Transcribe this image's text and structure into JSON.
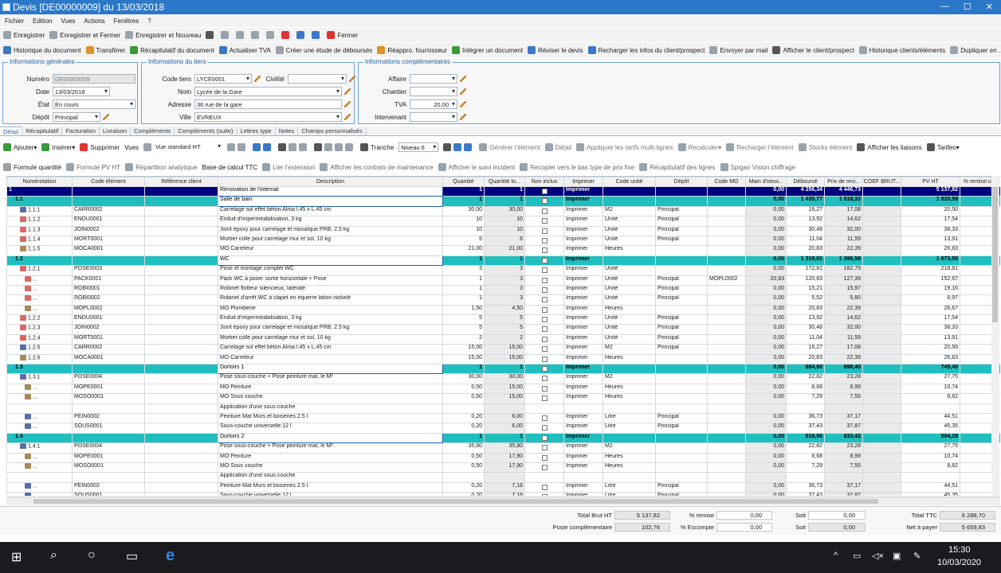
{
  "window": {
    "title": "Devis [DE00000009] du 13/03/2018",
    "minimize": "—",
    "maximize": "☐",
    "close": "✕"
  },
  "menu": [
    "Fichier",
    "Edition",
    "Vues",
    "Actions",
    "Fenêtres",
    "?"
  ],
  "toolbar1": [
    {
      "label": "Enregistrer",
      "icon": "save-icon",
      "color": "gray"
    },
    {
      "label": "Enregistrer et Fermer",
      "icon": "save-close-icon",
      "color": "gray"
    },
    {
      "label": "Enregistrer et Nouveau",
      "icon": "save-new-icon",
      "color": "gray"
    },
    {
      "label": "",
      "icon": "print-icon",
      "color": "dark"
    },
    {
      "label": "",
      "icon": "print-preview-icon",
      "color": "gray"
    },
    {
      "label": "",
      "icon": "undo-icon",
      "color": "gray"
    },
    {
      "label": "",
      "icon": "redo-icon",
      "color": "gray"
    },
    {
      "label": "",
      "icon": "copy-icon",
      "color": "gray"
    },
    {
      "label": "",
      "icon": "delete-icon",
      "color": "red"
    },
    {
      "label": "",
      "icon": "previous-icon",
      "color": "blue"
    },
    {
      "label": "",
      "icon": "next-icon",
      "color": "blue"
    },
    {
      "label": "Fermer",
      "icon": "close-doc-icon",
      "color": "red"
    }
  ],
  "toolbar2": [
    {
      "label": "Historique du document",
      "icon": "history-icon",
      "color": "blue"
    },
    {
      "label": "Transférer",
      "icon": "transfer-icon",
      "color": "orange"
    },
    {
      "label": "Récapitulatif du document",
      "icon": "summary-icon",
      "color": "green"
    },
    {
      "label": "Actualiser TVA",
      "icon": "refresh-vat-icon",
      "color": "blue"
    },
    {
      "label": "Créer une étude de déboursés",
      "icon": "study-icon",
      "color": "gray"
    },
    {
      "label": "Réappro. fournisseur",
      "icon": "supplier-icon",
      "color": "orange"
    },
    {
      "label": "Intégrer un document",
      "icon": "integrate-icon",
      "color": "green"
    },
    {
      "label": "Réviser le devis",
      "icon": "revise-icon",
      "color": "blue"
    },
    {
      "label": "Recharger les infos du client/prospect",
      "icon": "reload-client-icon",
      "color": "blue"
    },
    {
      "label": "Envoyer par mail",
      "icon": "mail-icon",
      "color": "gray"
    },
    {
      "label": "Afficher le client/prospect",
      "icon": "client-icon",
      "color": "dark"
    },
    {
      "label": "Historique clients/éléments",
      "icon": "client-history-icon",
      "color": "gray"
    },
    {
      "label": "Dupliquer en ...",
      "icon": "duplicate-icon",
      "color": "gray"
    }
  ],
  "general": {
    "legend": "Informations générales",
    "numero_label": "Numéro",
    "numero": "DE00000009",
    "date_label": "Date",
    "date": "13/03/2018",
    "etat_label": "État",
    "etat": "En cours",
    "depot_label": "Dépôt",
    "depot": "Principal"
  },
  "tiers": {
    "legend": "Informations du tiers",
    "code_label": "Code tiers",
    "code": "LYCE0001",
    "civilite_label": "Civilité",
    "civilite": "",
    "nom_label": "Nom",
    "nom": "Lycée de la Gare",
    "adresse_label": "Adresse",
    "adresse": "36 rue de la gare",
    "ville_label": "Ville",
    "ville": "EVREUX"
  },
  "compl": {
    "legend": "Informations complémentaires",
    "affaire_label": "Affaire",
    "affaire": "",
    "chantier_label": "Chantier",
    "chantier": "",
    "tva_label": "TVA",
    "tva": "20,00",
    "intervenant_label": "Intervenant",
    "intervenant": ""
  },
  "tabs": [
    "Détail",
    "Récapitulatif",
    "Facturation",
    "Livraison",
    "Compléments",
    "Compléments (suite)",
    "Lettres type",
    "Notes",
    "Champs personnalisés"
  ],
  "gridtools1": {
    "ajouter": "Ajouter",
    "inserer": "Insérer",
    "supprimer": "Supprimer",
    "vues": "Vues",
    "vue_value": "Vue standard HT",
    "tranche": "Tranche",
    "niveau": "Niveau 6",
    "generer": "Générer l'élément",
    "detail": "Détail",
    "appliquer": "Appliquer les tarifs multi-lignes",
    "recalculer": "Recalculer",
    "recharger": "Recharger l'élément",
    "stocks": "Stocks élément",
    "liaisons": "Afficher les liaisons",
    "tarifeo": "Tarifeo"
  },
  "gridtools2": [
    "Formule quantité",
    "Formule PV HT",
    "Répartition analytique",
    "Base de calcul TTC",
    "Lier l'extension",
    "Afficher les contrats de maintenance",
    "Afficher le suivi incident",
    "Recopier vers le bas type de prix fixe",
    "Récapitulatif des lignes",
    "Spigao Vision chiffrage"
  ],
  "columns": [
    "Numérotation",
    "Code élément",
    "Référence client",
    "Description",
    "Quantité",
    "Quantité to...",
    "Non inclus",
    "Imprimer",
    "Code unité",
    "Dépôt",
    "Code MO",
    "Main d'oeuv...",
    "Déboursé",
    "Prix de revi...",
    "COEF BRUT...",
    "PV HT",
    "% remise unit"
  ],
  "rows": [
    {
      "lv": 1,
      "num": "1",
      "code": "",
      "desc": "Rénovation de l'internat",
      "q": "1",
      "qt": "1",
      "imp": "Imprimer",
      "unit": "",
      "depot": "",
      "mo": "",
      "mod": "0,00",
      "deb": "4 256,34",
      "pr": "4 446,73",
      "pv": "5 137,82"
    },
    {
      "lv": 2,
      "num": "1.1",
      "code": "",
      "desc": "Salle de bain",
      "q": "1",
      "qt": "1",
      "imp": "Imprimer",
      "unit": "",
      "depot": "",
      "mo": "",
      "mod": "0,00",
      "deb": "1 435,77",
      "pr": "1 518,33",
      "pv": "1 820,59"
    },
    {
      "lv": 0,
      "num": "1.1.1",
      "code": "CARR0002",
      "desc": "Carrelage sol effet béton Alma l.45 x L.45 cm",
      "q": "30,00",
      "qt": "30,00",
      "imp": "Imprimer",
      "unit": "M2",
      "depot": "Principal",
      "mo": "",
      "mod": "0,00",
      "deb": "16,27",
      "pr": "17,08",
      "pv": "20,50"
    },
    {
      "lv": 0,
      "num": "1.1.2",
      "code": "ENDU0001",
      "desc": "Enduit d'imperméabilisation, 3 kg",
      "q": "10",
      "qt": "10",
      "imp": "Imprimer",
      "unit": "Unité",
      "depot": "Principal",
      "mo": "",
      "mod": "0,00",
      "deb": "13,92",
      "pr": "14,62",
      "pv": "17,54"
    },
    {
      "lv": 0,
      "num": "1.1.3",
      "code": "JOIN0002",
      "desc": "Joint époxy pour carrelage et mosaïque PRB, 2.5 kg",
      "q": "10",
      "qt": "10",
      "imp": "Imprimer",
      "unit": "Unité",
      "depot": "Principal",
      "mo": "",
      "mod": "0,00",
      "deb": "30,48",
      "pr": "32,00",
      "pv": "38,33"
    },
    {
      "lv": 0,
      "num": "1.1.4",
      "code": "MORT0001",
      "desc": "Mortier colle pour carrelage mur et sol, 10 kg",
      "q": "6",
      "qt": "6",
      "imp": "Imprimer",
      "unit": "Unité",
      "depot": "Principal",
      "mo": "",
      "mod": "0,00",
      "deb": "11,04",
      "pr": "11,59",
      "pv": "13,91"
    },
    {
      "lv": 0,
      "num": "1.1.5",
      "code": "MOCA0001",
      "desc": "MO Carreleur",
      "q": "21,00",
      "qt": "21,00",
      "imp": "Imprimer",
      "unit": "Heures",
      "depot": "",
      "mo": "",
      "mod": "0,00",
      "deb": "20,83",
      "pr": "22,39",
      "pv": "26,83"
    },
    {
      "lv": 2,
      "num": "1.2",
      "code": "",
      "desc": "WC",
      "q": "1",
      "qt": "1",
      "imp": "Imprimer",
      "unit": "",
      "depot": "",
      "mo": "",
      "mod": "0,00",
      "deb": "1 319,01",
      "pr": "1 396,58",
      "pv": "1 673,55"
    },
    {
      "lv": 0,
      "num": "1.2.1",
      "code": "POSE0003",
      "desc": "Pose et montage complet WC",
      "q": "3",
      "qt": "3",
      "imp": "Imprimer",
      "unit": "Unité",
      "depot": "",
      "mo": "",
      "mod": "0,00",
      "deb": "172,81",
      "pr": "182,75",
      "pv": "218,81"
    },
    {
      "lv": 0,
      "num": "...",
      "code": "PACK0001",
      "desc": "Pack WC à poser sortie horizontale + Pose",
      "q": "1",
      "qt": "3",
      "imp": "Imprimer",
      "unit": "Unité",
      "depot": "Principal",
      "mo": "MOPL0002",
      "mod": "20,83",
      "deb": "120,83",
      "pr": "127,39",
      "pv": "152,67"
    },
    {
      "lv": 0,
      "num": "...",
      "code": "ROBI0001",
      "desc": "Robinet flotteur silencieux, latérale",
      "q": "1",
      "qt": "3",
      "imp": "Imprimer",
      "unit": "Unité",
      "depot": "Principal",
      "mo": "",
      "mod": "0,00",
      "deb": "15,21",
      "pr": "15,97",
      "pv": "19,16"
    },
    {
      "lv": 0,
      "num": "...",
      "code": "ROBI0002",
      "desc": "Robinet d'arrêt WC à clapet en équerre laiton nickelé",
      "q": "1",
      "qt": "3",
      "imp": "Imprimer",
      "unit": "Unité",
      "depot": "Principal",
      "mo": "",
      "mod": "0,00",
      "deb": "5,52",
      "pr": "5,80",
      "pv": "6,97"
    },
    {
      "lv": 0,
      "num": "...",
      "code": "MOPL0002",
      "desc": "MO Plomberie",
      "q": "1,50",
      "qt": "4,50",
      "imp": "Imprimer",
      "unit": "Heures",
      "depot": "",
      "mo": "",
      "mod": "0,00",
      "deb": "20,83",
      "pr": "22,39",
      "pv": "26,67"
    },
    {
      "lv": 0,
      "num": "1.2.2",
      "code": "ENDU0001",
      "desc": "Enduit d'imperméabilisation, 3 kg",
      "q": "5",
      "qt": "5",
      "imp": "Imprimer",
      "unit": "Unité",
      "depot": "Principal",
      "mo": "",
      "mod": "0,00",
      "deb": "13,92",
      "pr": "14,62",
      "pv": "17,54"
    },
    {
      "lv": 0,
      "num": "1.2.3",
      "code": "JOIN0002",
      "desc": "Joint époxy pour carrelage et mosaïque PRB, 2.5 kg",
      "q": "5",
      "qt": "5",
      "imp": "Imprimer",
      "unit": "Unité",
      "depot": "Principal",
      "mo": "",
      "mod": "0,00",
      "deb": "30,48",
      "pr": "32,00",
      "pv": "38,33"
    },
    {
      "lv": 0,
      "num": "1.2.4",
      "code": "MORT0001",
      "desc": "Mortier colle pour carrelage mur et sol, 10 kg",
      "q": "2",
      "qt": "2",
      "imp": "Imprimer",
      "unit": "Unité",
      "depot": "Principal",
      "mo": "",
      "mod": "0,00",
      "deb": "11,04",
      "pr": "11,59",
      "pv": "13,91"
    },
    {
      "lv": 0,
      "num": "1.2.5",
      "code": "CARR0002",
      "desc": "Carrelage sol effet béton Alma l.45 x L.45 cm",
      "q": "15,00",
      "qt": "15,00",
      "imp": "Imprimer",
      "unit": "M2",
      "depot": "Principal",
      "mo": "",
      "mod": "0,00",
      "deb": "16,27",
      "pr": "17,08",
      "pv": "20,50"
    },
    {
      "lv": 0,
      "num": "1.2.6",
      "code": "MOCA0001",
      "desc": "MO Carreleur",
      "q": "15,00",
      "qt": "15,00",
      "imp": "Imprimer",
      "unit": "Heures",
      "depot": "",
      "mo": "",
      "mod": "0,00",
      "deb": "20,83",
      "pr": "22,39",
      "pv": "26,83"
    },
    {
      "lv": 2,
      "num": "1.3",
      "code": "",
      "desc": "Dortoirs 1",
      "q": "1",
      "qt": "1",
      "imp": "Imprimer",
      "unit": "",
      "depot": "",
      "mo": "",
      "mod": "0,00",
      "deb": "684,60",
      "pr": "698,40",
      "pv": "749,40"
    },
    {
      "lv": 0,
      "num": "1.3.1",
      "code": "POSE0004",
      "desc": "Pose sous-couche + Pose peinture mat, le M²",
      "q": "30,00",
      "qt": "30,00",
      "imp": "Imprimer",
      "unit": "M2",
      "depot": "",
      "mo": "",
      "mod": "0,00",
      "deb": "22,82",
      "pr": "23,28",
      "pv": "27,75"
    },
    {
      "lv": 0,
      "num": "...",
      "code": "MOPE0001",
      "desc": "MO Peinture",
      "q": "0,50",
      "qt": "15,00",
      "imp": "Imprimer",
      "unit": "Heures",
      "depot": "",
      "mo": "",
      "mod": "0,00",
      "deb": "8,68",
      "pr": "8,99",
      "pv": "10,74"
    },
    {
      "lv": 0,
      "num": "...",
      "code": "MOSO0001",
      "desc": "MO Sous couche",
      "q": "0,50",
      "qt": "15,00",
      "imp": "Imprimer",
      "unit": "Heures",
      "depot": "",
      "mo": "",
      "mod": "0,00",
      "deb": "7,29",
      "pr": "7,55",
      "pv": "8,82"
    },
    {
      "lv": 0,
      "num": "",
      "code": "",
      "desc": "Application d'une sous couche",
      "q": "",
      "qt": "",
      "imp": "",
      "unit": "",
      "depot": "",
      "mo": "",
      "mod": "",
      "deb": "",
      "pr": "",
      "pv": "",
      "cont": true
    },
    {
      "lv": 0,
      "num": "...",
      "code": "PEIN0002",
      "desc": "Peinture Mat Murs et boiseries 2.5 l",
      "q": "0,20",
      "qt": "6,00",
      "imp": "Imprimer",
      "unit": "Litre",
      "depot": "Principal",
      "mo": "",
      "mod": "0,00",
      "deb": "36,73",
      "pr": "37,17",
      "pv": "44,51"
    },
    {
      "lv": 0,
      "num": "...",
      "code": "SOUS0001",
      "desc": "Sous-couche universelle 12 l",
      "q": "0,20",
      "qt": "6,00",
      "imp": "Imprimer",
      "unit": "Litre",
      "depot": "Principal",
      "mo": "",
      "mod": "0,00",
      "deb": "37,43",
      "pr": "37,87",
      "pv": "45,35"
    },
    {
      "lv": 2,
      "num": "1.4",
      "code": "",
      "desc": "Dortoirs 2",
      "q": "1",
      "qt": "1",
      "imp": "Imprimer",
      "unit": "",
      "depot": "",
      "mo": "",
      "mod": "0,00",
      "deb": "816,96",
      "pr": "833,42",
      "pv": "894,28"
    },
    {
      "lv": 0,
      "num": "1.4.1",
      "code": "POSE0004",
      "desc": "Pose sous-couche + Pose peinture mat, le M²",
      "q": "35,80",
      "qt": "35,80",
      "imp": "Imprimer",
      "unit": "M2",
      "depot": "",
      "mo": "",
      "mod": "0,00",
      "deb": "22,82",
      "pr": "23,28",
      "pv": "27,75"
    },
    {
      "lv": 0,
      "num": "...",
      "code": "MOPE0001",
      "desc": "MO Peinture",
      "q": "0,50",
      "qt": "17,90",
      "imp": "Imprimer",
      "unit": "Heures",
      "depot": "",
      "mo": "",
      "mod": "0,00",
      "deb": "8,68",
      "pr": "8,99",
      "pv": "10,74"
    },
    {
      "lv": 0,
      "num": "...",
      "code": "MOSO0001",
      "desc": "MO Sous couche",
      "q": "0,50",
      "qt": "17,90",
      "imp": "Imprimer",
      "unit": "Heures",
      "depot": "",
      "mo": "",
      "mod": "0,00",
      "deb": "7,29",
      "pr": "7,55",
      "pv": "8,82"
    },
    {
      "lv": 0,
      "num": "",
      "code": "",
      "desc": "Application d'une sous couche",
      "q": "",
      "qt": "",
      "imp": "",
      "unit": "",
      "depot": "",
      "mo": "",
      "mod": "",
      "deb": "",
      "pr": "",
      "pv": "",
      "cont": true
    },
    {
      "lv": 0,
      "num": "...",
      "code": "PEIN0002",
      "desc": "Peinture Mat Murs et boiseries 2.5 l",
      "q": "0,20",
      "qt": "7,16",
      "imp": "Imprimer",
      "unit": "Litre",
      "depot": "Principal",
      "mo": "",
      "mod": "0,00",
      "deb": "36,73",
      "pr": "37,17",
      "pv": "44,51"
    },
    {
      "lv": 0,
      "num": "...",
      "code": "SOUS0001",
      "desc": "Sous-couche universelle 12 l",
      "q": "0,20",
      "qt": "7,16",
      "imp": "Imprimer",
      "unit": "Litre",
      "depot": "Principal",
      "mo": "",
      "mod": "0,00",
      "deb": "37,43",
      "pr": "37,87",
      "pv": "45,35"
    }
  ],
  "totals": {
    "total_brut_label": "Total Brut HT",
    "total_brut": "5 137,82",
    "poste_label": "Poste complémentaire",
    "poste": "102,76",
    "remise_label": "% remise",
    "remise": "0,00",
    "escompte_label": "% Escompte",
    "escompte": "0,00",
    "soit1_label": "Soit",
    "soit1": "0,00",
    "soit2_label": "Soit",
    "soit2": "0,00",
    "ttc_label": "Total TTC",
    "ttc": "6 288,70",
    "net_label": "Net à payer",
    "net": "5 659,83"
  },
  "taskbar": {
    "time": "15:30",
    "date": "10/03/2020"
  }
}
